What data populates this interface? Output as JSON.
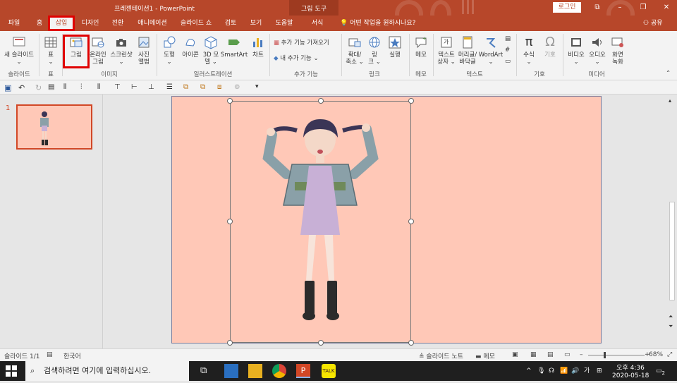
{
  "titlebar": {
    "document_title": "프레젠테이션1  -  PowerPoint",
    "tool_context": "그림 도구",
    "login_label": "로그인"
  },
  "tabs": [
    {
      "label": "파일"
    },
    {
      "label": "홈"
    },
    {
      "label": "삽입"
    },
    {
      "label": "디자인"
    },
    {
      "label": "전환"
    },
    {
      "label": "애니메이션"
    },
    {
      "label": "슬라이드 쇼"
    },
    {
      "label": "검토"
    },
    {
      "label": "보기"
    },
    {
      "label": "도움말"
    },
    {
      "label": "서식"
    }
  ],
  "tell_me": "어떤 작업을 원하시나요?",
  "share_label": "공유",
  "ribbon": {
    "new_slide": "새 슬라이드",
    "table": "표",
    "picture": "그림",
    "online_picture_1": "온라인",
    "online_picture_2": "그림",
    "screenshot": "스크린샷",
    "photo_album_1": "사진",
    "photo_album_2": "앨범",
    "shapes": "도형",
    "icons": "아이콘",
    "model3d_1": "3D 모",
    "model3d_2": "델",
    "smartart": "SmartArt",
    "chart": "차트",
    "get_addins": "추가 기능 가져오기",
    "my_addins": "내 추가 기능",
    "zoom_1": "확대/",
    "zoom_2": "축소",
    "link_1": "링",
    "link_2": "크",
    "action": "실행",
    "comment": "메모",
    "textbox_1": "텍스트",
    "textbox_2": "상자",
    "header_footer_1": "머리글/",
    "header_footer_2": "바닥글",
    "wordart": "WordArt",
    "equation": "수식",
    "symbol": "기호",
    "video": "비디오",
    "audio": "오디오",
    "screen_record_1": "화면",
    "screen_record_2": "녹화",
    "groups": {
      "slides": "슬라이드",
      "tables": "표",
      "images": "이미지",
      "illustrations": "일러스트레이션",
      "addins": "추가 기능",
      "links": "링크",
      "comments": "메모",
      "text": "텍스트",
      "symbols": "기호",
      "media": "미디어"
    }
  },
  "thumbnail": {
    "number": "1"
  },
  "statusbar": {
    "slide_info": "슬라이드 1/1",
    "language": "한국어",
    "notes": "슬라이드 노트",
    "comments": "메모",
    "zoom": "68%"
  },
  "taskbar": {
    "search_placeholder": "검색하려면 여기에 입력하십시오.",
    "time": "오후 4:36",
    "date": "2020-05-18",
    "ime": "가",
    "notification_count": "2"
  },
  "colors": {
    "accent": "#b7472a",
    "slide_bg": "#ffc8b7",
    "highlight_red": "#e00000"
  }
}
